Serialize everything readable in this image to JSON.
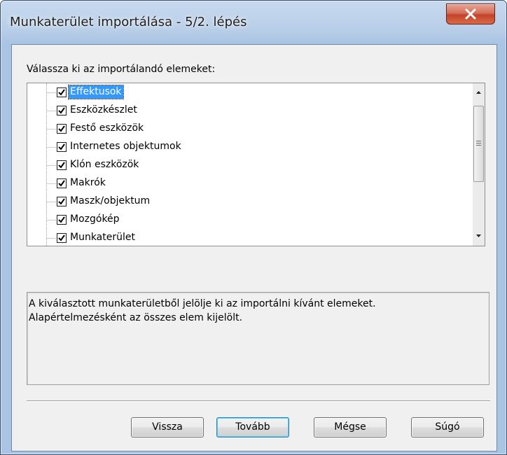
{
  "window": {
    "title": "Munkaterület importálása - 5/2. lépés"
  },
  "prompt_label": "Válassza ki az importálandó elemeket:",
  "tree": {
    "items": [
      {
        "label": "Effektusok",
        "checked": true,
        "selected": true
      },
      {
        "label": "Eszközkészlet",
        "checked": true,
        "selected": false
      },
      {
        "label": "Festő eszközök",
        "checked": true,
        "selected": false
      },
      {
        "label": "Internetes objektumok",
        "checked": true,
        "selected": false
      },
      {
        "label": "Klón eszközök",
        "checked": true,
        "selected": false
      },
      {
        "label": "Makrók",
        "checked": true,
        "selected": false
      },
      {
        "label": "Maszk/objektum",
        "checked": true,
        "selected": false
      },
      {
        "label": "Mozgókép",
        "checked": true,
        "selected": false
      },
      {
        "label": "Munkaterület",
        "checked": true,
        "selected": false
      }
    ]
  },
  "description": {
    "line1": "A kiválasztott munkaterületből jelölje ki az importálni kívánt elemeket.",
    "line2": "Alapértelmezésként az összes elem kijelölt."
  },
  "buttons": {
    "back": "Vissza",
    "next": "Tovább",
    "cancel": "Mégse",
    "help": "Súgó"
  },
  "icons": {
    "close": "close-icon",
    "check": "checkmark-icon",
    "scroll_up": "scroll-up-arrow-icon",
    "scroll_down": "scroll-down-arrow-icon"
  },
  "colors": {
    "selection": "#3399ff",
    "close_button": "#c4432a",
    "title_bar": "#b9cfe8",
    "dialog_face": "#f0f0f0"
  }
}
